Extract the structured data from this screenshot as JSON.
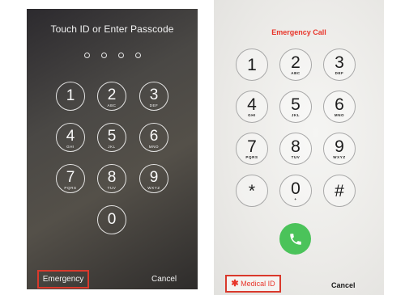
{
  "lock_screen": {
    "title": "Touch ID or Enter Passcode",
    "passcode_dots": 4,
    "keys": [
      {
        "digit": "1",
        "letters": ""
      },
      {
        "digit": "2",
        "letters": "ABC"
      },
      {
        "digit": "3",
        "letters": "DEF"
      },
      {
        "digit": "4",
        "letters": "GHI"
      },
      {
        "digit": "5",
        "letters": "JKL"
      },
      {
        "digit": "6",
        "letters": "MNO"
      },
      {
        "digit": "7",
        "letters": "PQRS"
      },
      {
        "digit": "8",
        "letters": "TUV"
      },
      {
        "digit": "9",
        "letters": "WXYZ"
      },
      {
        "digit": "0",
        "letters": ""
      }
    ],
    "emergency_label": "Emergency",
    "cancel_label": "Cancel"
  },
  "emergency_screen": {
    "title": "Emergency Call",
    "keys": [
      {
        "digit": "1",
        "letters": ""
      },
      {
        "digit": "2",
        "letters": "ABC"
      },
      {
        "digit": "3",
        "letters": "DEF"
      },
      {
        "digit": "4",
        "letters": "GHI"
      },
      {
        "digit": "5",
        "letters": "JKL"
      },
      {
        "digit": "6",
        "letters": "MNO"
      },
      {
        "digit": "7",
        "letters": "PQRS"
      },
      {
        "digit": "8",
        "letters": "TUV"
      },
      {
        "digit": "9",
        "letters": "WXYZ"
      },
      {
        "digit": "*",
        "letters": ""
      },
      {
        "digit": "0",
        "letters": "+"
      },
      {
        "digit": "#",
        "letters": ""
      }
    ],
    "call_icon": "phone-icon",
    "medical_id_label": "Medical ID",
    "medical_id_icon": "asterisk-icon",
    "cancel_label": "Cancel"
  },
  "colors": {
    "highlight_box": "#d9392c",
    "emergency_red": "#e8352a",
    "call_green": "#4bc35a"
  }
}
